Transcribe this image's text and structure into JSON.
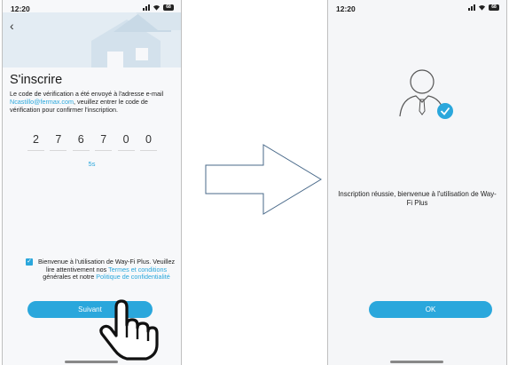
{
  "left_screen": {
    "status_time": "12:20",
    "battery": "68",
    "title": "S'inscrire",
    "description_pre": "Le code de vérification a été envoyé à l'adresse e-mail ",
    "email": "Ncastillo@fermax.com",
    "description_post": ", veuillez entrer le code de vérification pour confirmer l'inscription.",
    "code_digits": [
      "2",
      "7",
      "6",
      "7",
      "0",
      "0"
    ],
    "timer": "5s",
    "consent_text_1": "Bienvenue à l'utilisation de Way-Fi Plus. Veuillez lire attentivement nos",
    "terms_link": "Termes et conditions",
    "consent_text_2": " générales et notre ",
    "privacy_link": "Politique de confidentialité",
    "next_button": "Suivant"
  },
  "right_screen": {
    "status_time": "12:20",
    "battery": "68",
    "success_message": "Inscription réussie, bienvenue à l'utilisation de Way-Fi Plus",
    "ok_button": "OK"
  },
  "colors": {
    "accent": "#2aa7dc",
    "hero": "#dde8f0"
  },
  "icons": [
    "back-chevron-icon",
    "signal-icon",
    "wifi-icon",
    "battery-icon",
    "checkbox-checked-icon",
    "pointing-hand-icon",
    "user-avatar-icon",
    "check-circle-icon",
    "arrow-right-outline-icon"
  ]
}
